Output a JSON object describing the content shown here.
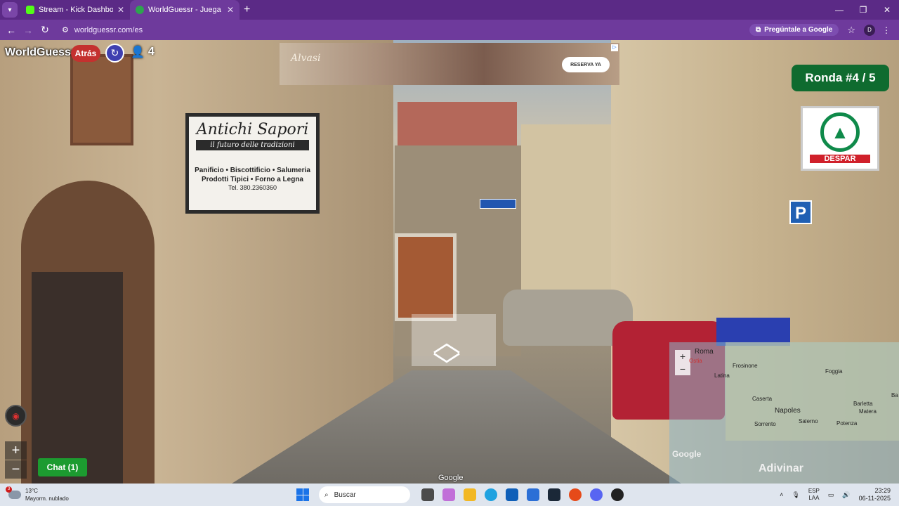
{
  "browser": {
    "tabs": [
      {
        "title": "Stream - Kick Dashboard",
        "favicon_color": "#53fc18",
        "active": false
      },
      {
        "title": "WorldGuessr - Juega GeoGuess",
        "favicon_color": "#2ea44f",
        "active": true
      }
    ],
    "new_tab": "+",
    "url": "worldguessr.com/es",
    "ask_google": "Pregúntale a Google",
    "profile_initial": "D"
  },
  "game": {
    "logo": "WorldGuessr",
    "back_label": "Atrás",
    "players_count": "4",
    "round_label": "Ronda #4 / 5",
    "chat_label": "Chat (1)",
    "guess_label": "Adivinar",
    "zoom_in": "+",
    "zoom_out": "−"
  },
  "street": {
    "shop_sign": {
      "name": "Antichi Sapori",
      "tagline": "il futuro delle tradizioni",
      "line1": "Panificio • Biscottificio • Salumeria",
      "line2": "Prodotti Tipici • Forno a Legna",
      "phone": "Tel. 380.2360360"
    },
    "store_sign": "DESPAR",
    "parking": "P",
    "google_watermark": "Google"
  },
  "ad": {
    "brand": "Alvasi",
    "cta": "RESERVA YA"
  },
  "minimap": {
    "zoom_in": "+",
    "zoom_out": "−",
    "cities": [
      "Roma",
      "Ostia",
      "Frosinone",
      "Latina",
      "Foggia",
      "Barletta",
      "Caserta",
      "Napoles",
      "Salerno",
      "Sorrento",
      "Potenza",
      "Matera",
      "Ba"
    ],
    "google": "Google"
  },
  "taskbar": {
    "notification_count": "3",
    "temperature": "13°C",
    "condition": "Mayorm. nublado",
    "search_label": "Buscar",
    "lang_top": "ESP",
    "lang_bottom": "LAA",
    "time": "23:29",
    "date": "06-11-2025"
  },
  "colors": {
    "browser_frame": "#5b2a86",
    "round_badge": "#0f6b2f",
    "back_button": "#c4312f",
    "chat_button": "#1c9b30"
  }
}
